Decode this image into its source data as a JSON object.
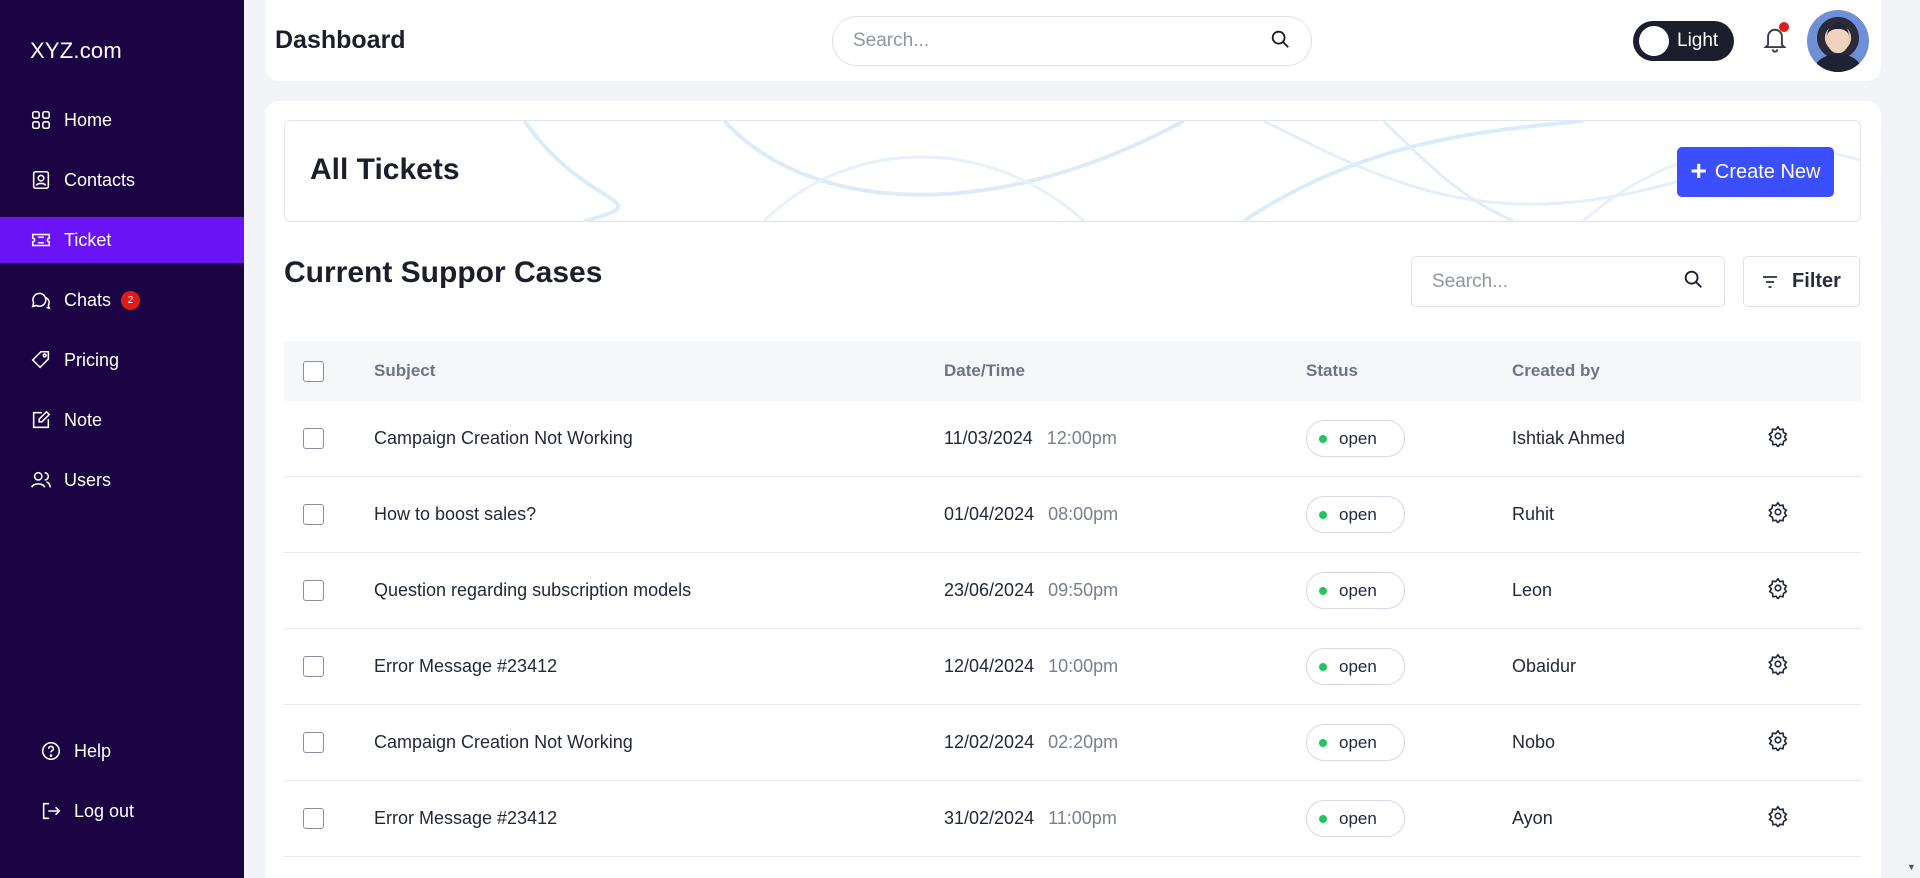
{
  "sidebar": {
    "logo": "XYZ.com",
    "items": [
      {
        "label": "Home",
        "icon": "grid-icon"
      },
      {
        "label": "Contacts",
        "icon": "contact-card-icon"
      },
      {
        "label": "Ticket",
        "icon": "ticket-icon",
        "active": true
      },
      {
        "label": "Chats",
        "icon": "chat-icon",
        "badge": "2"
      },
      {
        "label": "Pricing",
        "icon": "price-tag-icon"
      },
      {
        "label": "Note",
        "icon": "note-edit-icon"
      },
      {
        "label": "Users",
        "icon": "users-icon"
      }
    ],
    "bottom": [
      {
        "label": "Help",
        "icon": "help-circle-icon"
      },
      {
        "label": "Log out",
        "icon": "logout-icon"
      }
    ]
  },
  "header": {
    "title": "Dashboard",
    "search_placeholder": "Search...",
    "theme_label": "Light"
  },
  "banner": {
    "title": "All Tickets",
    "create_label": "Create New"
  },
  "cases": {
    "title": "Current Suppor Cases",
    "search_placeholder": "Search...",
    "filter_label": "Filter",
    "columns": {
      "subject": "Subject",
      "datetime": "Date/Time",
      "status": "Status",
      "created_by": "Created by"
    },
    "rows": [
      {
        "subject": "Campaign Creation Not Working",
        "date": "11/03/2024",
        "time": "12:00pm",
        "status": "open",
        "created_by": "Ishtiak Ahmed"
      },
      {
        "subject": "How to boost sales?",
        "date": "01/04/2024",
        "time": "08:00pm",
        "status": "open",
        "created_by": "Ruhit"
      },
      {
        "subject": "Question regarding subscription models",
        "date": "23/06/2024",
        "time": "09:50pm",
        "status": "open",
        "created_by": "Leon"
      },
      {
        "subject": "Error Message #23412",
        "date": "12/04/2024",
        "time": "10:00pm",
        "status": "open",
        "created_by": "Obaidur"
      },
      {
        "subject": "Campaign Creation Not Working",
        "date": "12/02/2024",
        "time": "02:20pm",
        "status": "open",
        "created_by": "Nobo"
      },
      {
        "subject": "Error Message #23412",
        "date": "31/02/2024",
        "time": "11:00pm",
        "status": "open",
        "created_by": "Ayon"
      }
    ]
  },
  "colors": {
    "sidebar_bg": "#1c0444",
    "active_nav": "#6a13f5",
    "primary_button": "#3c4fff",
    "status_open_dot": "#22c55e",
    "badge_red": "#e01b1b"
  }
}
